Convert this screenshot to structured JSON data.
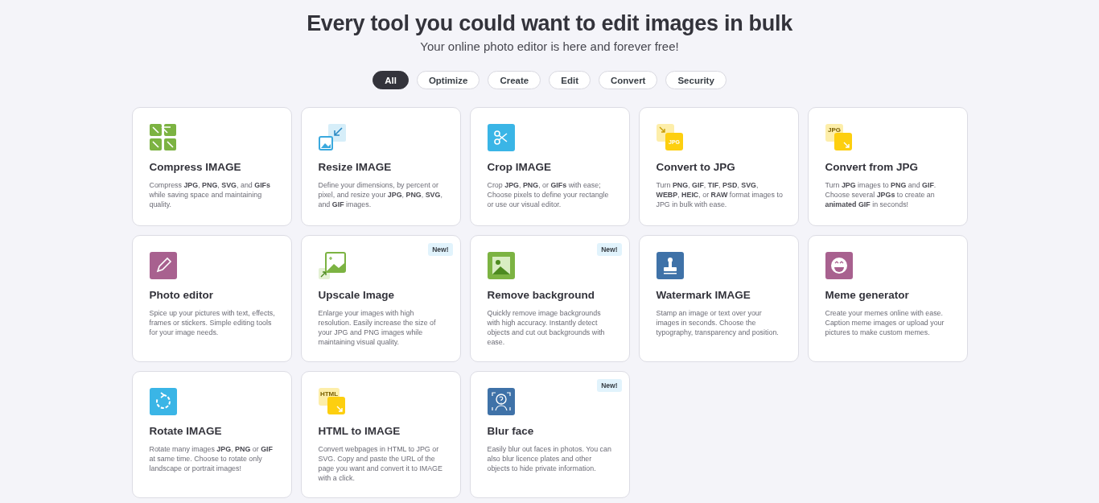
{
  "header": {
    "title": "Every tool you could want to edit images in bulk",
    "subtitle": "Your online photo editor is here and forever free!"
  },
  "filters": [
    {
      "label": "All",
      "selected": true
    },
    {
      "label": "Optimize",
      "selected": false
    },
    {
      "label": "Create",
      "selected": false
    },
    {
      "label": "Edit",
      "selected": false
    },
    {
      "label": "Convert",
      "selected": false
    },
    {
      "label": "Security",
      "selected": false
    }
  ],
  "tools": [
    {
      "kind": "compress",
      "title": "Compress IMAGE",
      "description": "Compress **JPG**, **PNG**, **SVG**, and **GIFs** while saving space and maintaining quality.",
      "is_new": false
    },
    {
      "kind": "resize",
      "title": "Resize IMAGE",
      "description": "Define your dimensions, by percent or pixel, and resize your **JPG**, **PNG**, **SVG**, and **GIF** images.",
      "is_new": false
    },
    {
      "kind": "crop",
      "title": "Crop IMAGE",
      "description": "Crop **JPG**, **PNG**, or **GIFs** with ease; Choose pixels to define your rectangle or use our visual editor.",
      "is_new": false
    },
    {
      "kind": "to_jpg",
      "icon_text": "JPG",
      "title": "Convert to JPG",
      "description": "Turn **PNG**, **GIF**, **TIF**, **PSD**, **SVG**, **WEBP**, **HEIC**, or **RAW** format images to JPG in bulk with ease.",
      "is_new": false
    },
    {
      "kind": "from_jpg",
      "icon_text": "JPG",
      "title": "Convert from JPG",
      "description": "Turn **JPG** images to **PNG** and **GIF**. Choose several **JPGs** to create an **animated GIF** in seconds!",
      "is_new": false
    },
    {
      "kind": "editor",
      "title": "Photo editor",
      "description": "Spice up your pictures with text, effects, frames or stickers. Simple editing tools for your image needs.",
      "is_new": false
    },
    {
      "kind": "upscale",
      "title": "Upscale Image",
      "description": "Enlarge your images with high resolution. Easily increase the size of your JPG and PNG images while maintaining visual quality.",
      "is_new": true,
      "badge": "New!"
    },
    {
      "kind": "remove_bg",
      "title": "Remove background",
      "description": "Quickly remove image backgrounds with high accuracy. Instantly detect objects and cut out backgrounds with ease.",
      "is_new": true,
      "badge": "New!"
    },
    {
      "kind": "watermark",
      "title": "Watermark IMAGE",
      "description": "Stamp an image or text over your images in seconds. Choose the typography, transparency and position.",
      "is_new": false
    },
    {
      "kind": "meme",
      "title": "Meme generator",
      "description": "Create your memes online with ease. Caption meme images or upload your pictures to make custom memes.",
      "is_new": false
    },
    {
      "kind": "rotate",
      "title": "Rotate IMAGE",
      "description": "Rotate many images **JPG**, **PNG** or **GIF** at same time. Choose to rotate only landscape or portrait images!",
      "is_new": false
    },
    {
      "kind": "html",
      "icon_text": "HTML",
      "title": "HTML to IMAGE",
      "description": "Convert webpages in HTML to JPG or SVG. Copy and paste the URL of the page you want and convert it to IMAGE with a click.",
      "is_new": false
    },
    {
      "kind": "blur",
      "title": "Blur face",
      "description": "Easily blur out faces in photos. You can also blur licence plates and other objects to hide private information.",
      "is_new": true,
      "badge": "New!"
    }
  ]
}
